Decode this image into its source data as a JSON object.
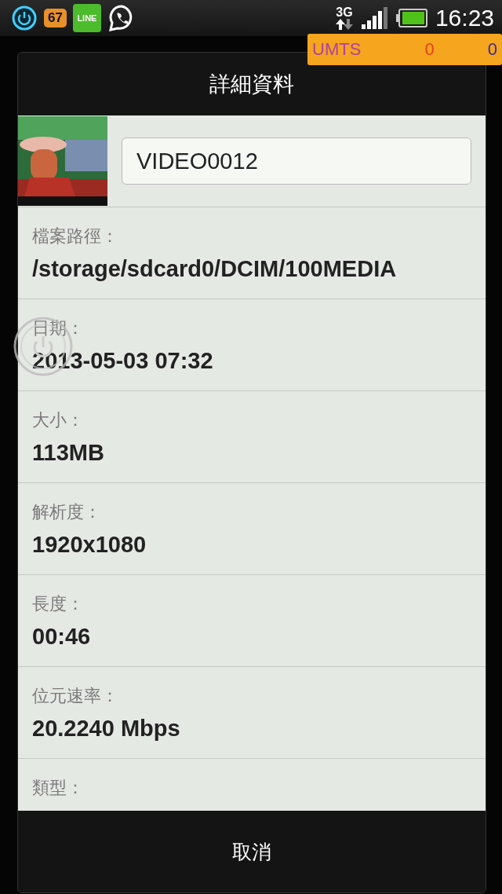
{
  "status_bar": {
    "badge_count": "67",
    "line_label": "LINE",
    "network": "3G",
    "time": "16:23"
  },
  "data_monitor": {
    "network": "UMTS",
    "value_1": "0",
    "value_2": "0"
  },
  "dialog": {
    "title": "詳細資料",
    "name_field": {
      "value": "VIDEO0012"
    },
    "details": [
      {
        "label": "檔案路徑：",
        "value": "/storage/sdcard0/DCIM/100MEDIA"
      },
      {
        "label": "日期：",
        "value": "2013-05-03 07:32"
      },
      {
        "label": "大小：",
        "value": "113MB"
      },
      {
        "label": "解析度：",
        "value": "1920x1080"
      },
      {
        "label": "長度：",
        "value": "00:46"
      },
      {
        "label": "位元速率：",
        "value": "20.2240 Mbps"
      },
      {
        "label": "類型："
      }
    ],
    "cancel_button": "取消"
  }
}
